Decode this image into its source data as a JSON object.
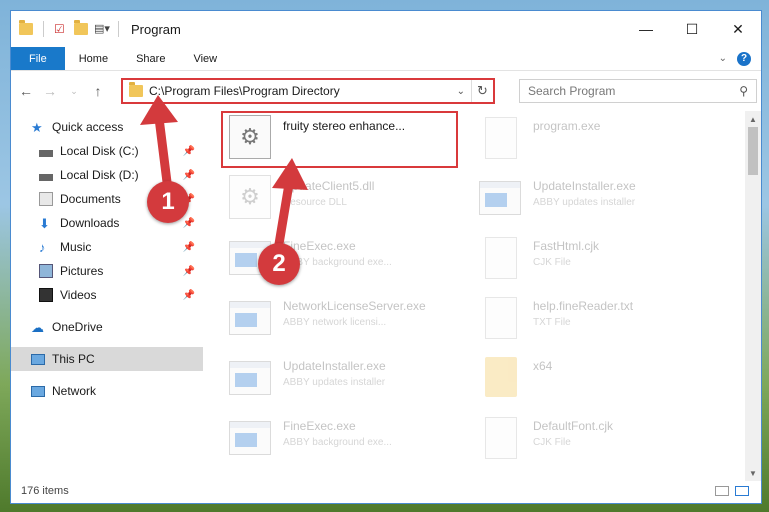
{
  "window": {
    "title": "Program"
  },
  "ribbon": {
    "tabs": [
      "File",
      "Home",
      "Share",
      "View"
    ]
  },
  "address": {
    "path": "C:\\Program Files\\Program Directory"
  },
  "search": {
    "placeholder": "Search Program"
  },
  "sidebar": {
    "items": [
      {
        "label": "Quick access",
        "icon": "star-icon"
      },
      {
        "label": "Local Disk (C:)",
        "icon": "drive-icon"
      },
      {
        "label": "Local Disk (D:)",
        "icon": "drive-icon"
      },
      {
        "label": "Documents",
        "icon": "documents-icon"
      },
      {
        "label": "Downloads",
        "icon": "download-icon"
      },
      {
        "label": "Music",
        "icon": "music-icon"
      },
      {
        "label": "Pictures",
        "icon": "pictures-icon"
      },
      {
        "label": "Videos",
        "icon": "videos-icon"
      },
      {
        "label": "OneDrive",
        "icon": "cloud-icon"
      },
      {
        "label": "This PC",
        "icon": "computer-icon"
      },
      {
        "label": "Network",
        "icon": "network-icon"
      }
    ]
  },
  "files": [
    {
      "name": "fruity stereo enhance...",
      "type": ""
    },
    {
      "name": "program.exe",
      "type": ""
    },
    {
      "name": "UpdateClient5.dll",
      "type": "Resource DLL"
    },
    {
      "name": "UpdateInstaller.exe",
      "type": "ABBY updates installer"
    },
    {
      "name": "FineExec.exe",
      "type": "ABBY background exe..."
    },
    {
      "name": "FastHtml.cjk",
      "type": "CJK File"
    },
    {
      "name": "NetworkLicenseServer.exe",
      "type": "ABBY network licensi..."
    },
    {
      "name": "help.fineReader.txt",
      "type": "TXT File"
    },
    {
      "name": "UpdateInstaller.exe",
      "type": "ABBY updates installer"
    },
    {
      "name": "x64",
      "type": ""
    },
    {
      "name": "FineExec.exe",
      "type": "ABBY background exe..."
    },
    {
      "name": "DefaultFont.cjk",
      "type": "CJK File"
    }
  ],
  "status": {
    "count": "176 items"
  },
  "annotations": {
    "step1": "1",
    "step2": "2",
    "color": "#d33a3d"
  }
}
